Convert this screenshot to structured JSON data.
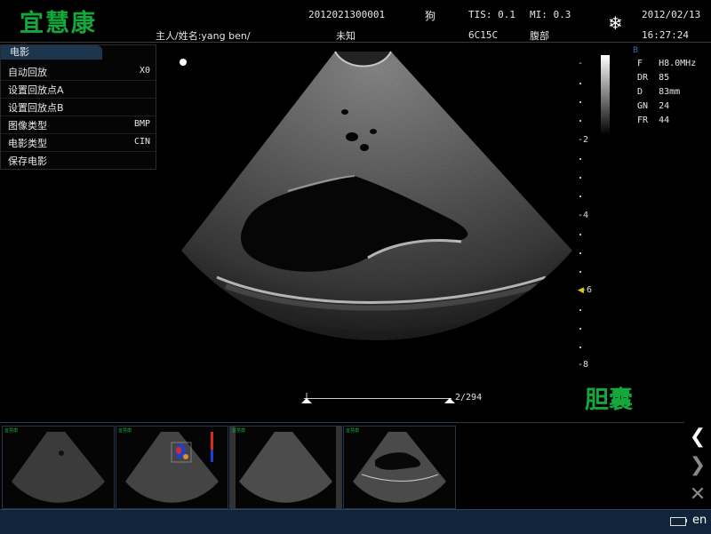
{
  "header": {
    "logo": "宜慧康",
    "patient_id": "2012021300001",
    "species": "狗",
    "tis": "TIS: 0.1",
    "mi": "MI: 0.3",
    "date": "2012/02/13",
    "owner_name": "主人/姓名:yang ben/",
    "gender": "未知",
    "probe": "6C15C",
    "region": "腹部",
    "time": "16:27:24"
  },
  "menu": {
    "title": "电影",
    "items": [
      {
        "label": "自动回放",
        "value": "X0"
      },
      {
        "label": "设置回放点A",
        "value": ""
      },
      {
        "label": "设置回放点B",
        "value": ""
      },
      {
        "label": "图像类型",
        "value": "BMP"
      },
      {
        "label": "电影类型",
        "value": "CIN"
      },
      {
        "label": "保存电影",
        "value": ""
      }
    ]
  },
  "depth_scale": {
    "top": "-",
    "labels": [
      "-2",
      "-4",
      "-6",
      "-8"
    ]
  },
  "params": {
    "mode": "B",
    "freq": "F   H8.0MHz",
    "dr": "DR  85",
    "depth": "D   83mm",
    "gain": "GN  24",
    "frame_rate": "FR  44"
  },
  "cine": {
    "counter": "2/294"
  },
  "body_label": "胆囊",
  "thumbnails": [
    {
      "logo": "宜慧康",
      "type": "b-mode"
    },
    {
      "logo": "宜慧康",
      "type": "color-doppler"
    },
    {
      "logo": "宜慧康",
      "type": "b-mode"
    },
    {
      "logo": "宜慧康",
      "type": "gallbladder"
    }
  ],
  "nav": {
    "prev": "❮",
    "next": "❯",
    "close": "✕"
  },
  "status": {
    "language": "en"
  },
  "colors": {
    "brand_green": "#13a83c",
    "status_bar": "#12243a",
    "menu_title": "#1c3650"
  }
}
